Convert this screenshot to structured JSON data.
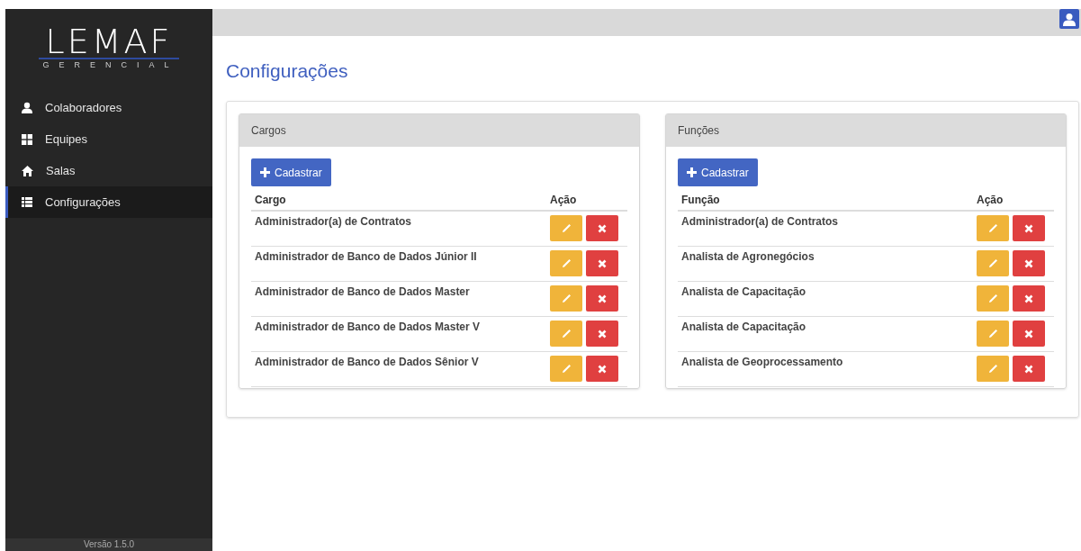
{
  "sidebar": {
    "logo": {
      "name": "LEMAF",
      "subtitle": "GERENCIAL"
    },
    "items": [
      {
        "label": "Colaboradores",
        "kind": "people",
        "selected": false
      },
      {
        "label": "Equipes",
        "kind": "teams",
        "selected": false
      },
      {
        "label": "Salas",
        "kind": "rooms",
        "selected": false
      },
      {
        "label": "Configurações",
        "kind": "settings",
        "selected": true
      }
    ],
    "version": "Versão 1.5.0"
  },
  "page_title": "Configurações",
  "panels": [
    {
      "title": "Cargos",
      "add_button": "Cadastrar",
      "columns": [
        "Cargo",
        "Ação"
      ],
      "rows": [
        "Administrador(a) de Contratos",
        "Administrador de Banco de Dados Júnior II",
        "Administrador de Banco de Dados Master",
        "Administrador de Banco de Dados Master V",
        "Administrador de Banco de Dados Sênior V"
      ]
    },
    {
      "title": "Funções",
      "add_button": "Cadastrar",
      "columns": [
        "Função",
        "Ação"
      ],
      "rows": [
        "Administrador(a) de Contratos",
        "Analista de Agronegócios",
        "Analista de Capacitação",
        "Analista de Capacitação",
        "Analista de Geoprocessamento"
      ]
    }
  ]
}
